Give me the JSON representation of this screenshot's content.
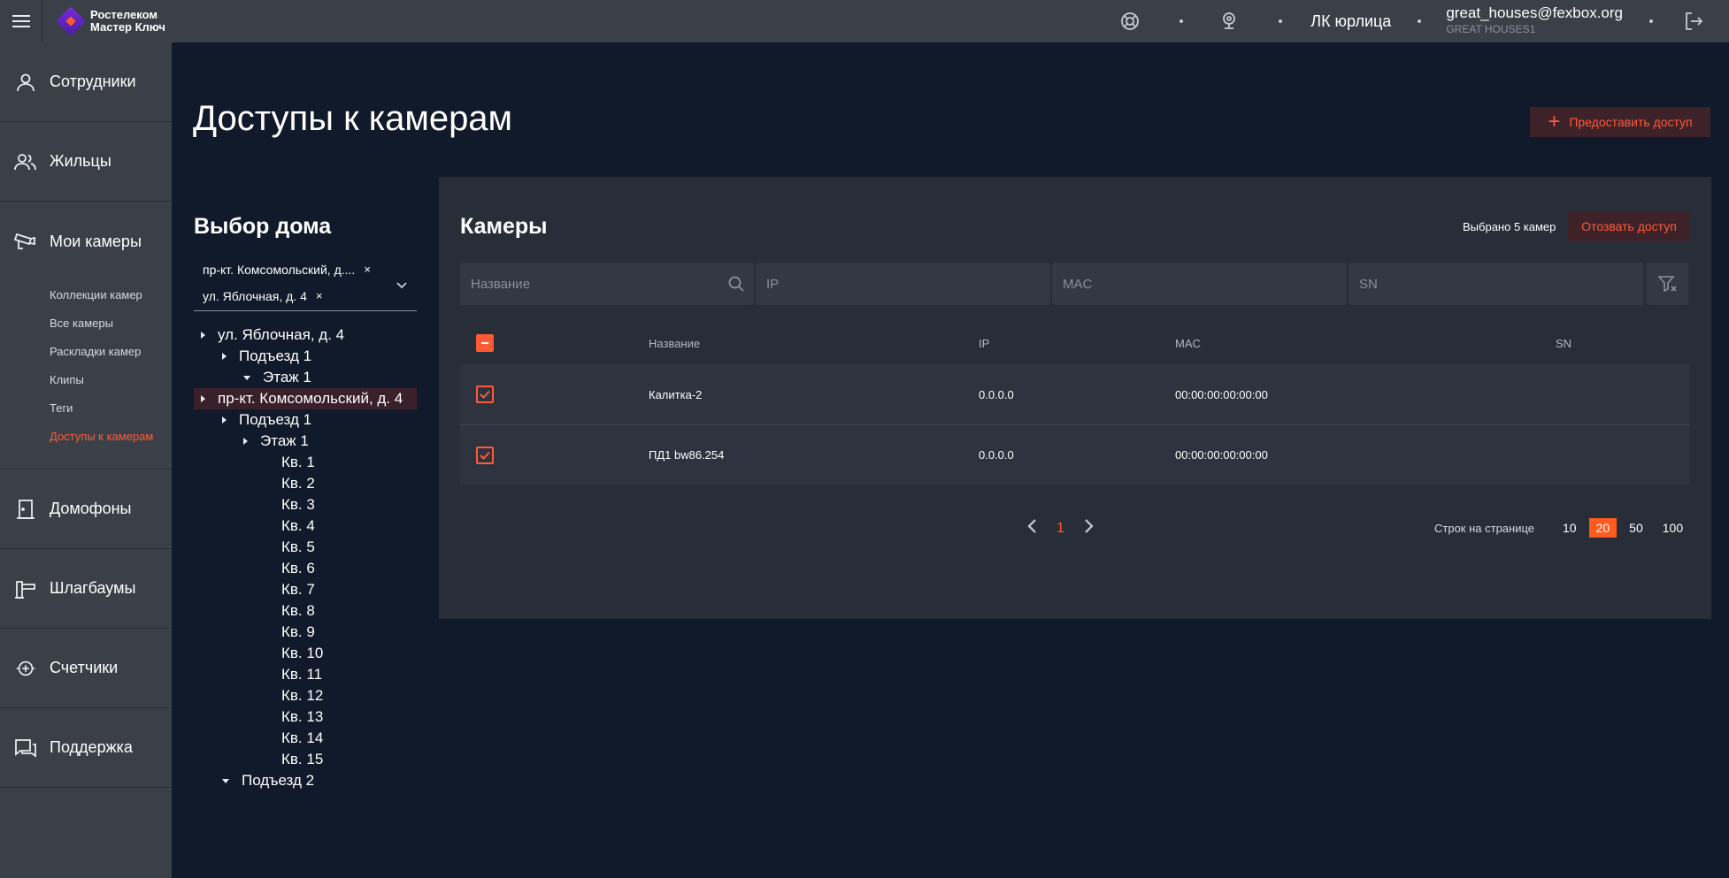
{
  "header": {
    "logo_line1": "Ростелеком",
    "logo_line2": "Мастер Ключ",
    "account_type": "ЛК юрлица",
    "user_email": "great_houses@fexbox.org",
    "user_org": "GREAT HOUSES1"
  },
  "sidebar": {
    "items": [
      {
        "label": "Сотрудники",
        "icon": "user-icon"
      },
      {
        "label": "Жильцы",
        "icon": "users-icon"
      },
      {
        "label": "Мои камеры",
        "icon": "camera-icon"
      },
      {
        "label": "Домофоны",
        "icon": "door-icon"
      },
      {
        "label": "Шлагбаумы",
        "icon": "barrier-icon"
      },
      {
        "label": "Счетчики",
        "icon": "meter-icon"
      },
      {
        "label": "Поддержка",
        "icon": "chat-icon"
      }
    ],
    "camera_sub": [
      "Коллекции камер",
      "Все камеры",
      "Раскладки камер",
      "Клипы",
      "Теги",
      "Доступы к камерам"
    ],
    "active_sub": "Доступы к камерам"
  },
  "page": {
    "title": "Доступы к камерам",
    "grant_button": "Предоставить доступ"
  },
  "house": {
    "title": "Выбор дома",
    "chips": [
      "пр-кт. Комсомольский, д....",
      "ул. Яблочная, д. 4"
    ],
    "chip_remove": "×",
    "tree": [
      {
        "label": "ул. Яблочная, д. 4",
        "level": 0,
        "toggle": "right"
      },
      {
        "label": "Подъезд 1",
        "level": 1,
        "toggle": "right"
      },
      {
        "label": "Этаж 1",
        "level": 2,
        "toggle": "down"
      },
      {
        "label": "пр-кт. Комсомольский, д. 4",
        "level": 0,
        "toggle": "right",
        "selected": true
      },
      {
        "label": "Подъезд 1",
        "level": 1,
        "toggle": "right"
      },
      {
        "label": "Этаж 1",
        "level": 2,
        "toggle": "right"
      },
      {
        "label": "Кв. 1",
        "level": 3,
        "toggle": "none"
      },
      {
        "label": "Кв. 2",
        "level": 3,
        "toggle": "none"
      },
      {
        "label": "Кв. 3",
        "level": 3,
        "toggle": "none"
      },
      {
        "label": "Кв. 4",
        "level": 3,
        "toggle": "none"
      },
      {
        "label": "Кв. 5",
        "level": 3,
        "toggle": "none"
      },
      {
        "label": "Кв. 6",
        "level": 3,
        "toggle": "none"
      },
      {
        "label": "Кв. 7",
        "level": 3,
        "toggle": "none"
      },
      {
        "label": "Кв. 8",
        "level": 3,
        "toggle": "none"
      },
      {
        "label": "Кв. 9",
        "level": 3,
        "toggle": "none"
      },
      {
        "label": "Кв. 10",
        "level": 3,
        "toggle": "none"
      },
      {
        "label": "Кв. 11",
        "level": 3,
        "toggle": "none"
      },
      {
        "label": "Кв. 12",
        "level": 3,
        "toggle": "none"
      },
      {
        "label": "Кв. 13",
        "level": 3,
        "toggle": "none"
      },
      {
        "label": "Кв. 14",
        "level": 3,
        "toggle": "none"
      },
      {
        "label": "Кв. 15",
        "level": 3,
        "toggle": "none"
      },
      {
        "label": "Подъезд 2",
        "level": 1,
        "toggle": "down"
      }
    ]
  },
  "cameras": {
    "title": "Камеры",
    "selected_text": "Выбрано 5 камер",
    "revoke_button": "Отозвать доступ",
    "filters": {
      "name_placeholder": "Название",
      "ip_placeholder": "IP",
      "mac_placeholder": "MAC",
      "sn_placeholder": "SN"
    },
    "columns": {
      "name": "Название",
      "ip": "IP",
      "mac": "MAC",
      "sn": "SN"
    },
    "rows": [
      {
        "name": "Калитка-2",
        "ip": "0.0.0.0",
        "mac": "00:00:00:00:00:00",
        "sn": "",
        "checked": true
      },
      {
        "name": "ПД1 bw86.254",
        "ip": "0.0.0.0",
        "mac": "00:00:00:00:00:00",
        "sn": "",
        "checked": true
      }
    ],
    "pagination": {
      "current_page": "1"
    },
    "rows_per_page": {
      "label": "Строк на странице",
      "options": [
        "10",
        "20",
        "50",
        "100"
      ],
      "selected": "20"
    }
  },
  "colors": {
    "accent": "#ff5a36",
    "bg": "#111a2a",
    "panel": "#282e38",
    "sidebar": "#3b4048"
  }
}
